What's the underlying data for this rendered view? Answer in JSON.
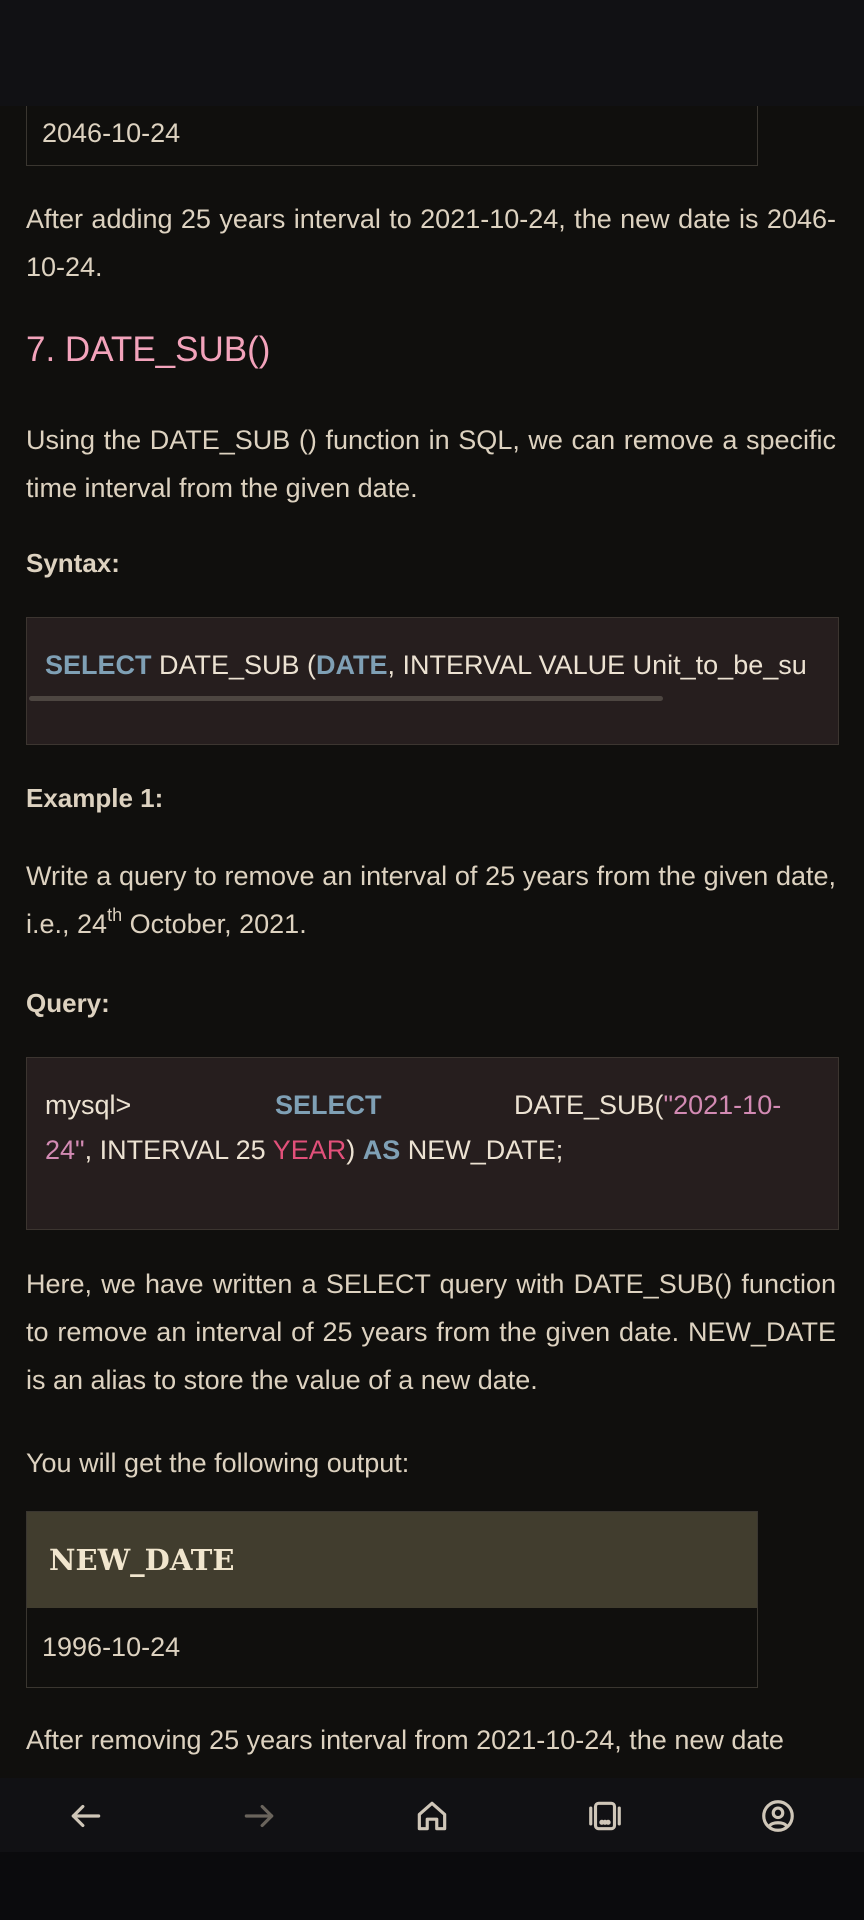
{
  "article": {
    "prev_table_value": "2046-10-24",
    "prev_result_text": "After adding 25 years interval to 2021-10-24, the new date is 2046-10-24.",
    "section_heading": "7. DATE_SUB()",
    "section_intro": "Using the DATE_SUB () function in SQL, we can remove a specific time interval from the given date.",
    "syntax_label": "Syntax:",
    "syntax_code": {
      "kw1": "SELECT",
      "part1": " DATE_SUB (",
      "kw2": "DATE",
      "part2": ", INTERVAL VALUE Unit_to_be_su"
    },
    "example_label": "Example 1:",
    "example_text_pre": "Write a query to remove an interval of 25 years from the given date, i.e., 24",
    "example_text_sup": "th",
    "example_text_post": " October, 2021.",
    "query_label": "Query:",
    "query_code": {
      "prompt": "mysql>",
      "kw_select": "SELECT",
      "fn": "DATE_SUB(",
      "str_a": "\"2021-10-",
      "str_b": "24\"",
      "mid": ", INTERVAL 25 ",
      "unit": "YEAR",
      "close": ") ",
      "kw_as": "AS",
      "alias": " NEW_DATE;"
    },
    "explanation": "Here, we have written a SELECT query with DATE_SUB() function to remove an interval of 25 years from the given date. NEW_DATE is an alias to store the value of a new date.",
    "output_intro": "You will get the following output:",
    "result_table": {
      "header": "NEW_DATE",
      "value": "1996-10-24"
    },
    "result_text": "After removing 25 years interval from 2021-10-24, the new date"
  },
  "nav": {
    "back": "back-arrow-icon",
    "forward": "forward-arrow-icon",
    "home": "home-icon",
    "tabs": "tabs-icon",
    "account": "account-icon"
  },
  "colors": {
    "background": "#100f0d",
    "heading": "#f3a3bb",
    "keyword": "#7fa0b5",
    "string": "#d28ab3",
    "unit": "#e2507a",
    "table_header_bg": "#413d2e"
  }
}
